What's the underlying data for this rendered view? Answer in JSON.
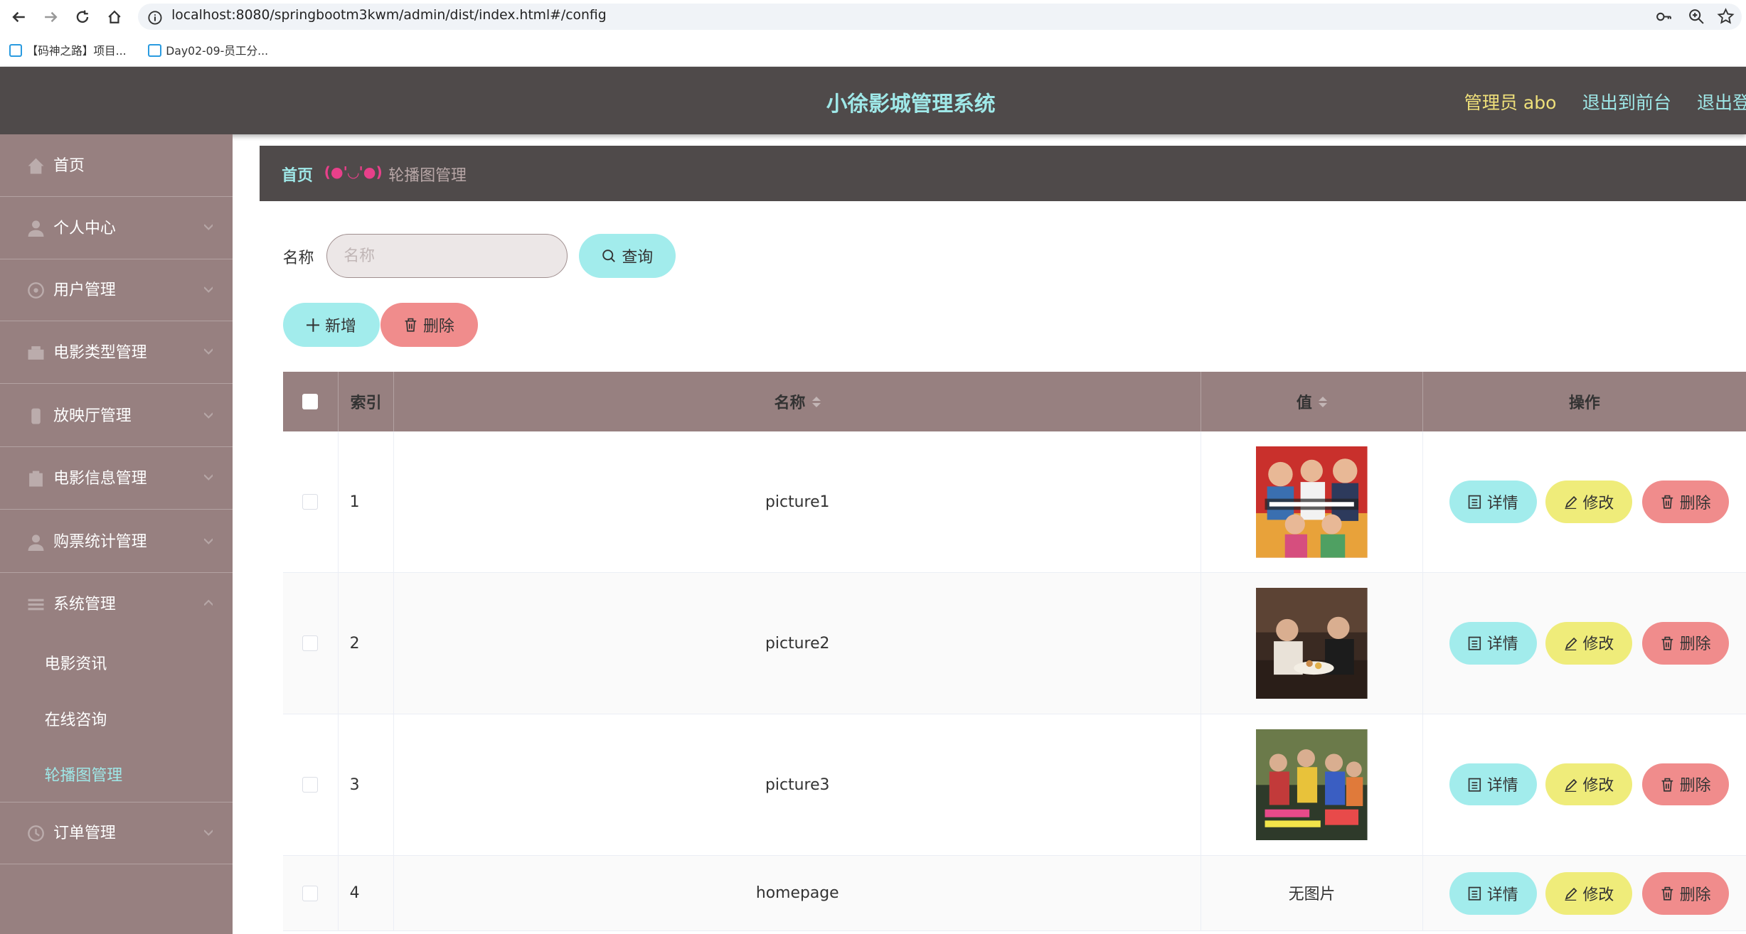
{
  "browser": {
    "url": "localhost:8080/springbootm3kwm/admin/dist/index.html#/config",
    "bookmarks": [
      "【码神之路】项目...",
      "Day02-09-员工分..."
    ]
  },
  "header": {
    "title": "小徐影城管理系统",
    "admin": "管理员 abo",
    "back_front": "退出到前台",
    "logout": "退出登录"
  },
  "sidebar": {
    "items": [
      {
        "label": "首页",
        "icon": "home-icon"
      },
      {
        "label": "个人中心",
        "icon": "user-icon"
      },
      {
        "label": "用户管理",
        "icon": "users-icon"
      },
      {
        "label": "电影类型管理",
        "icon": "folder-icon"
      },
      {
        "label": "放映厅管理",
        "icon": "hall-icon"
      },
      {
        "label": "电影信息管理",
        "icon": "film-icon"
      },
      {
        "label": "购票统计管理",
        "icon": "chart-icon"
      },
      {
        "label": "系统管理",
        "icon": "menu-icon"
      }
    ],
    "sub_items": [
      "电影资讯",
      "在线咨询",
      "轮播图管理"
    ],
    "last_item": {
      "label": "订单管理",
      "icon": "order-icon"
    }
  },
  "breadcrumb": {
    "home": "首页",
    "separator": "(●'◡'●)",
    "current": "轮播图管理"
  },
  "search": {
    "label": "名称",
    "placeholder": "名称",
    "query_button": "查询"
  },
  "toolbar": {
    "add": "新增",
    "delete": "删除"
  },
  "table": {
    "headers": {
      "index": "索引",
      "name": "名称",
      "value": "值",
      "actions": "操作"
    },
    "rows": [
      {
        "index": "1",
        "name": "picture1",
        "value": ""
      },
      {
        "index": "2",
        "name": "picture2",
        "value": ""
      },
      {
        "index": "3",
        "name": "picture3",
        "value": ""
      },
      {
        "index": "4",
        "name": "homepage",
        "value": "无图片"
      }
    ],
    "actions": {
      "detail": "详情",
      "edit": "修改",
      "delete": "删除"
    }
  },
  "colors": {
    "header_bg": "#4f4a4a",
    "sidebar_bg": "#978080",
    "accent_cyan": "#a2ecec",
    "accent_pink": "#f08c8c",
    "accent_yellow": "#efec7a",
    "active_menu": "#9fe8e8"
  }
}
